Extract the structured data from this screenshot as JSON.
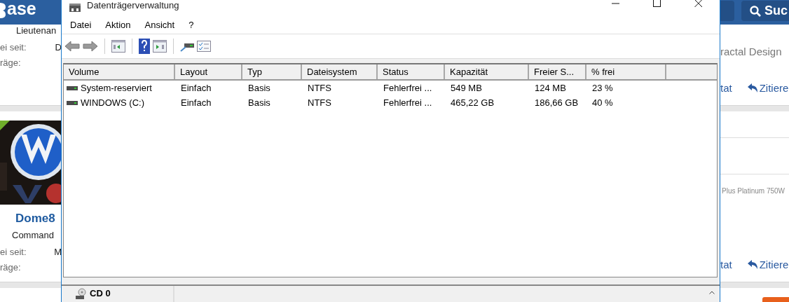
{
  "forum": {
    "logo": "ase",
    "search_button": "Suc",
    "posts": [
      {
        "rank": "Lieutenan",
        "since_label": "ei seit:",
        "since_value": "D",
        "posts_label": "räge:",
        "right_text": "ractal Design",
        "quote_cut": "tat",
        "quote": "Zitiere"
      },
      {
        "username": "Dome8",
        "rank": "Command",
        "since_label": "ei seit:",
        "since_value": "M",
        "posts_label": "räge:",
        "signature": "Plus Platinum 750W",
        "quote_cut": "tat",
        "quote": "Zitiere"
      }
    ]
  },
  "window": {
    "title": "Datenträgerverwaltung",
    "menu": [
      "Datei",
      "Aktion",
      "Ansicht",
      "?"
    ],
    "table": {
      "columns": [
        "Volume",
        "Layout",
        "Typ",
        "Dateisystem",
        "Status",
        "Kapazität",
        "Freier S...",
        "% frei"
      ],
      "rows": [
        {
          "cells": [
            "System-reserviert",
            "Einfach",
            "Basis",
            "NTFS",
            "Fehlerfrei ...",
            "549 MB",
            "124 MB",
            "23 %"
          ]
        },
        {
          "cells": [
            "WINDOWS (C:)",
            "Einfach",
            "Basis",
            "NTFS",
            "Fehlerfrei ...",
            "465,22 GB",
            "186,66 GB",
            "40 %"
          ]
        }
      ]
    },
    "disks": [
      {
        "name": "CD 0"
      }
    ]
  }
}
